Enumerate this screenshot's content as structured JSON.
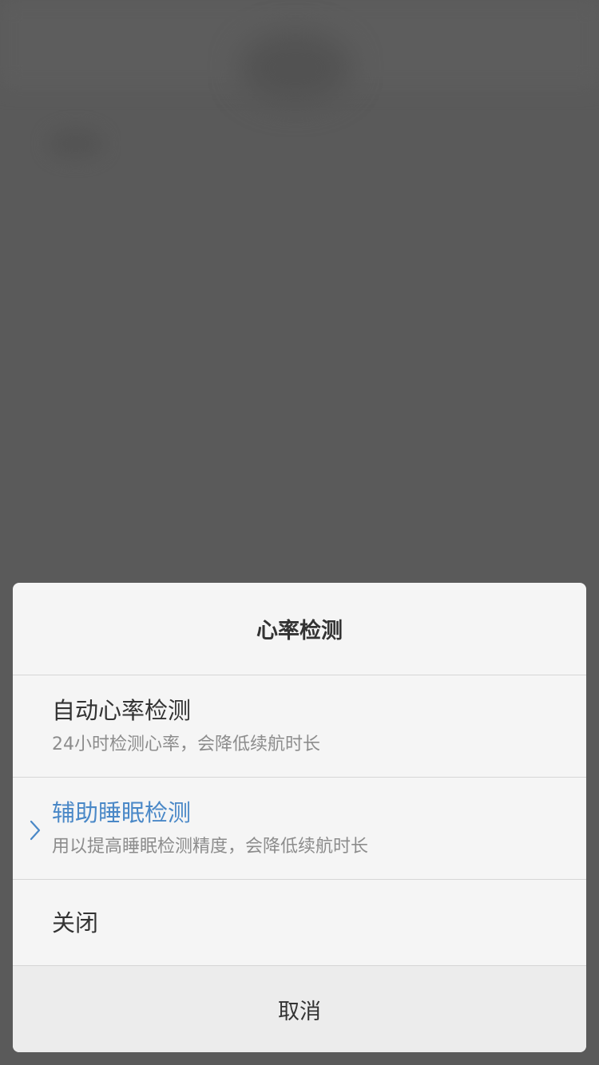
{
  "dialog": {
    "title": "心率检测",
    "options": [
      {
        "title": "自动心率检测",
        "subtitle": "24小时检测心率，会降低续航时长",
        "selected": false
      },
      {
        "title": "辅助睡眠检测",
        "subtitle": "用以提高睡眠检测精度，会降低续航时长",
        "selected": true
      },
      {
        "title": "关闭",
        "selected": false
      }
    ],
    "cancel_label": "取消"
  },
  "colors": {
    "overlay": "#5a5a5a",
    "sheet": "#f5f5f5",
    "accent": "#4a88c7",
    "text_primary": "#333333",
    "text_secondary": "#8c8c8c",
    "divider": "#d6d6d6"
  },
  "icons": {
    "selected_marker": "chevron-right-icon"
  }
}
